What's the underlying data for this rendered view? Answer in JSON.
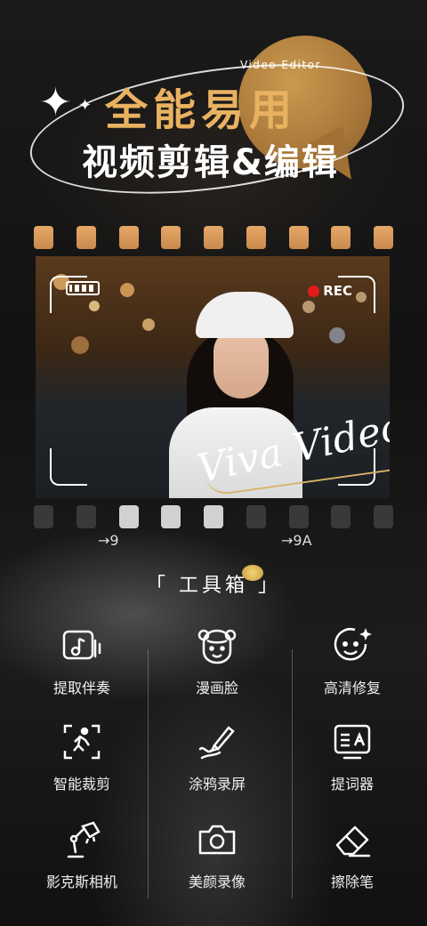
{
  "hero": {
    "badge": "Video Editor",
    "title_line1": "全能易用",
    "title_line2": "视频剪辑&编辑",
    "sparkle": "✦"
  },
  "film": {
    "rec_label": "REC",
    "overlay_script": "Viva Video",
    "marker_left": "→9",
    "marker_right": "→9A",
    "accent_color": "#e9b261"
  },
  "toolbox": {
    "title": "「 工具箱 」",
    "items": [
      {
        "label": "提取伴奏",
        "icon": "music-extract-icon"
      },
      {
        "label": "漫画脸",
        "icon": "cartoon-face-icon"
      },
      {
        "label": "高清修复",
        "icon": "hd-restore-icon"
      },
      {
        "label": "智能裁剪",
        "icon": "smart-crop-icon"
      },
      {
        "label": "涂鸦录屏",
        "icon": "doodle-record-icon"
      },
      {
        "label": "提词器",
        "icon": "teleprompter-icon"
      },
      {
        "label": "影克斯相机",
        "icon": "lamp-camera-icon"
      },
      {
        "label": "美颜录像",
        "icon": "camera-icon"
      },
      {
        "label": "擦除笔",
        "icon": "eraser-icon"
      }
    ]
  }
}
